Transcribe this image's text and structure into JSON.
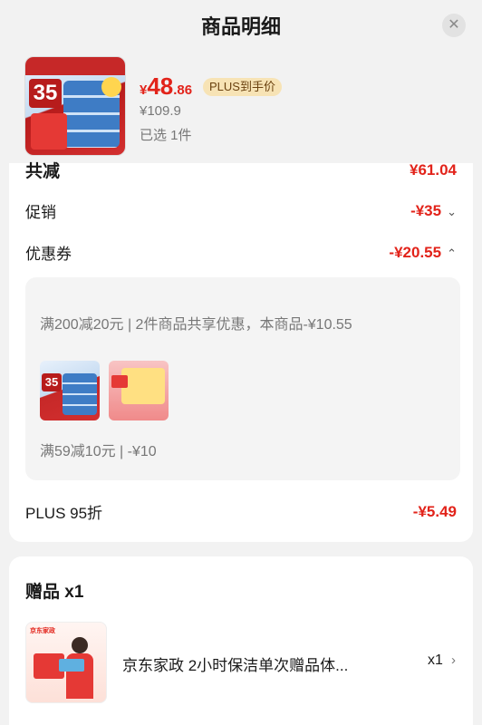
{
  "header": {
    "title": "商品明细",
    "close_icon": "✕"
  },
  "product": {
    "currency": "¥",
    "price_int": "48",
    "price_dec": ".86",
    "plus_tag": "PLUS到手价",
    "original_price": "¥109.9",
    "selected_count": "已选 1件",
    "thumb_badge": "35"
  },
  "breakdown": {
    "total_label": "共减",
    "total_amount": "¥61.04",
    "promo_label": "促销",
    "promo_amount": "-¥35",
    "coupon_label": "优惠券",
    "coupon_amount": "-¥20.55",
    "coupons": [
      {
        "text": "满200减20元 | 2件商品共享优惠，本商品-¥10.55"
      },
      {
        "text": "满59减10元 | -¥10"
      }
    ],
    "coupon_thumb_badge": "35",
    "plus_label": "PLUS 95折",
    "plus_amount": "-¥5.49"
  },
  "gifts": {
    "title": "赠品 x1",
    "items": [
      {
        "name": "京东家政 2小时保洁单次赠品体...",
        "qty": "x1",
        "logo": "京东家政"
      }
    ]
  },
  "colors": {
    "accent_red": "#e2231a",
    "plus_gold_bg": "#f7e3b5",
    "page_bg": "#f2f2f2"
  }
}
